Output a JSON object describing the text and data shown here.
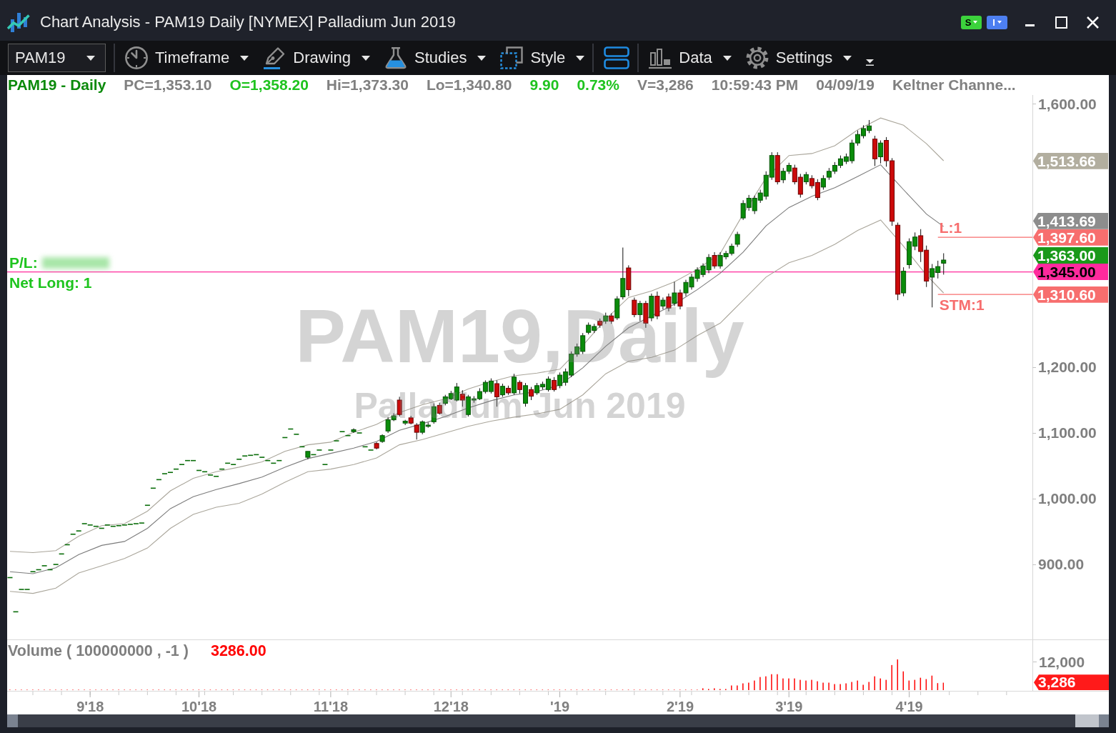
{
  "window": {
    "title": "Chart Analysis - PAM19 Daily [NYMEX] Palladium Jun 2019",
    "badges": [
      {
        "label": "S",
        "color": "#3cd23c"
      },
      {
        "label": "I",
        "color": "#4d7ff0"
      }
    ]
  },
  "toolbar": {
    "symbol": "PAM19",
    "groups": [
      [
        {
          "kind": "timeframe",
          "label": "Timeframe"
        },
        {
          "kind": "drawing",
          "label": "Drawing"
        },
        {
          "kind": "studies",
          "label": "Studies"
        },
        {
          "kind": "style",
          "label": "Style"
        }
      ],
      [
        {
          "kind": "layout"
        }
      ],
      [
        {
          "kind": "data",
          "label": "Data"
        },
        {
          "kind": "settings",
          "label": "Settings"
        },
        {
          "kind": "overflow"
        }
      ]
    ]
  },
  "chart": {
    "legend": [
      {
        "text": "PAM19 - Daily",
        "color": "#0b8a0b"
      },
      {
        "text": "PC=1,353.10",
        "color": "#808080"
      },
      {
        "text": "O=1,358.20",
        "color": "#1fc31f"
      },
      {
        "text": "Hi=1,373.30",
        "color": "#808080"
      },
      {
        "text": "Lo=1,340.80",
        "color": "#808080"
      },
      {
        "text": "9.90",
        "color": "#1fc31f"
      },
      {
        "text": "0.73%",
        "color": "#1fc31f"
      },
      {
        "text": "V=3,286",
        "color": "#808080"
      },
      {
        "text": "10:59:43 PM",
        "color": "#808080"
      },
      {
        "text": "04/09/19",
        "color": "#808080"
      },
      {
        "text": "Keltner Channe...",
        "color": "#808080"
      }
    ],
    "watermark": {
      "title": "PAM19,Daily",
      "subtitle": "Palladium Jun 2019"
    },
    "position": {
      "pl_label": "P/L:",
      "pl_value_hidden": true,
      "status": "Net Long: 1"
    },
    "price_flags": [
      {
        "kind": "study",
        "value": "1,513.66",
        "color": "#b2ae9f"
      },
      {
        "kind": "study",
        "value": "1,413.69",
        "color": "#8d8d8d"
      },
      {
        "kind": "order",
        "value": "1,397.60",
        "color": "#f76e6e",
        "tag": "L:1"
      },
      {
        "kind": "last",
        "value": "1,363.00",
        "color": "#1a991a"
      },
      {
        "kind": "position",
        "value": "1,345.00",
        "color": "#ff2a9d"
      },
      {
        "kind": "order",
        "value": "1,310.60",
        "color": "#f76e6e",
        "tag": "STM:1"
      }
    ],
    "price_axis": [
      "1,600.00",
      "1,200.00",
      "1,100.00",
      "1,000.00",
      "900.00"
    ]
  },
  "volume": {
    "title": "Volume ( 100000000 , -1 )",
    "reading": "3286.00",
    "axis_label": "12,000",
    "flag": {
      "value": "3,286",
      "color": "#ff1a1a"
    }
  },
  "time_axis": [
    "9'18",
    "10'18",
    "11'18",
    "12'18",
    "'19",
    "2'19",
    "3'19",
    "4'19"
  ]
}
